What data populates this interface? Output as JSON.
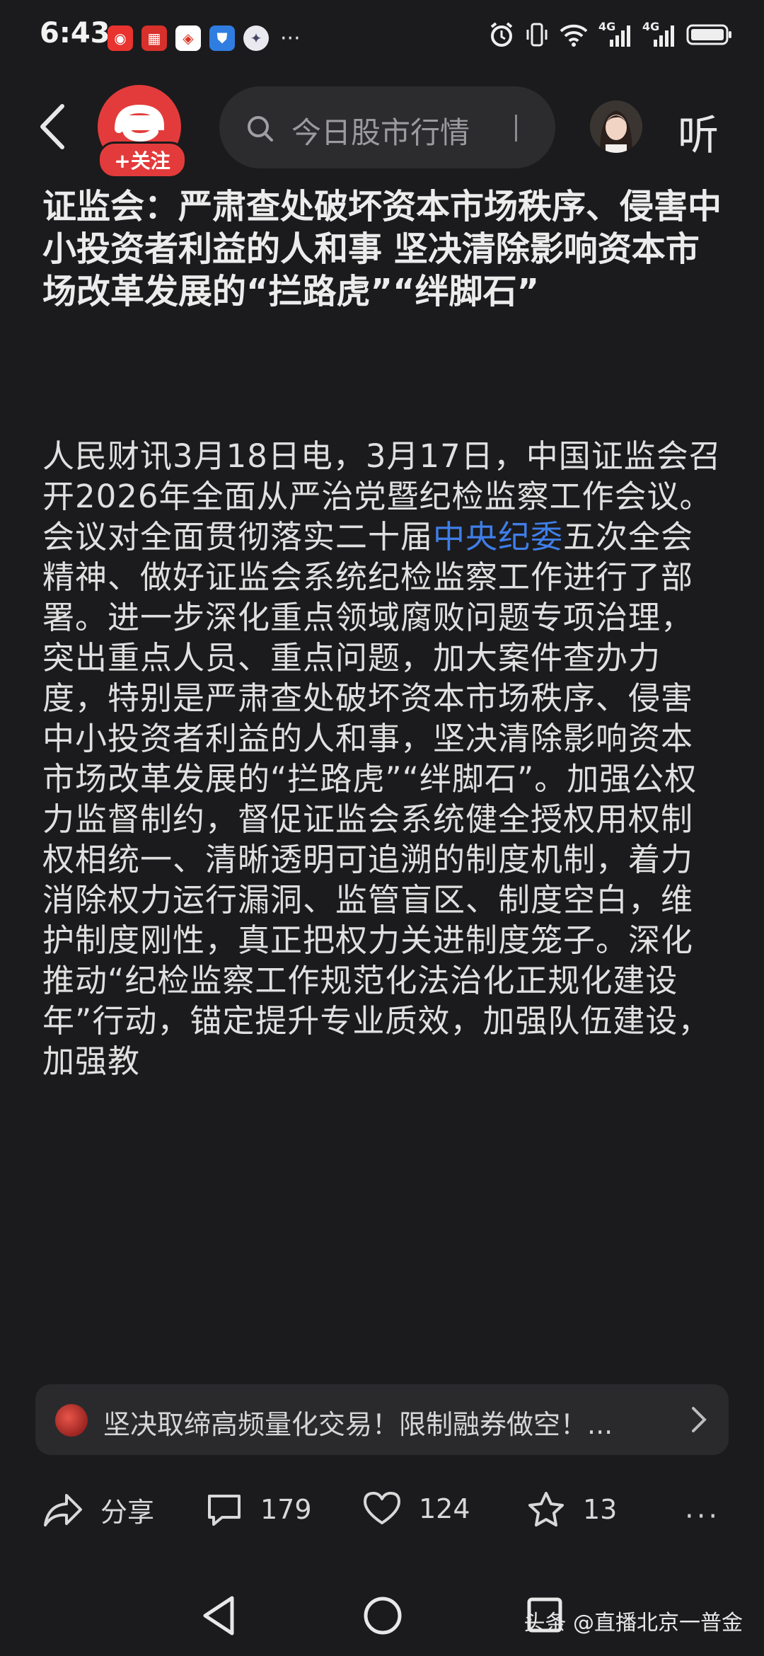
{
  "status_bar": {
    "time": "6:43",
    "more": "···",
    "notification_icons": [
      "news-app-icon",
      "lottery-app-icon",
      "bank-app-icon",
      "shield-app-icon",
      "custom-app-icon"
    ],
    "system_icons": [
      "alarm-icon",
      "vibrate-icon",
      "wifi-icon",
      "signal-4g-icon",
      "signal-4g-icon",
      "battery-icon"
    ],
    "network_label_1": "4G",
    "network_label_2": "4G"
  },
  "top_bar": {
    "follow_label": "+关注",
    "search_placeholder": "今日股市行情",
    "listen_label": "听"
  },
  "article": {
    "title": "证监会：严肃查处破坏资本市场秩序、侵害中小投资者利益的人和事 坚决清除影响资本市场改革发展的“拦路虎”“绊脚石”",
    "body_before_link": "人民财讯3月18日电，3月17日，中国证监会召开2026年全面从严治党暨纪检监察工作会议。会议对全面贯彻落实二十届",
    "body_link": "中央纪委",
    "body_after_link": "五次全会精神、做好证监会系统纪检监察工作进行了部署。进一步深化重点领域腐败问题专项治理，突出重点人员、重点问题，加大案件查办力度，特别是严肃查处破坏资本市场秩序、侵害中小投资者利益的人和事，坚决清除影响资本市场改革发展的“拦路虎”“绊脚石”。加强公权力监督制约，督促证监会系统健全授权用权制权相统一、清晰透明可追溯的制度机制，着力消除权力运行漏洞、监管盲区、制度空白，维护制度刚性，真正把权力关进制度笼子。深化推动“纪检监察工作规范化法治化正规化建设年”行动，锚定提升专业质效，加强队伍建设，加强教"
  },
  "promo": {
    "text": "坚决取缔高频量化交易！限制融券做空！..."
  },
  "actions": {
    "share_label": "分享",
    "comments_count": "179",
    "likes_count": "124",
    "favorites_count": "13",
    "more": "···"
  },
  "nav_bar": {
    "watermark": "头条 @直播北京一普金"
  },
  "colors": {
    "background": "#1b1b1d",
    "accent_red": "#e33b3b",
    "link_blue": "#3f7ee8"
  }
}
